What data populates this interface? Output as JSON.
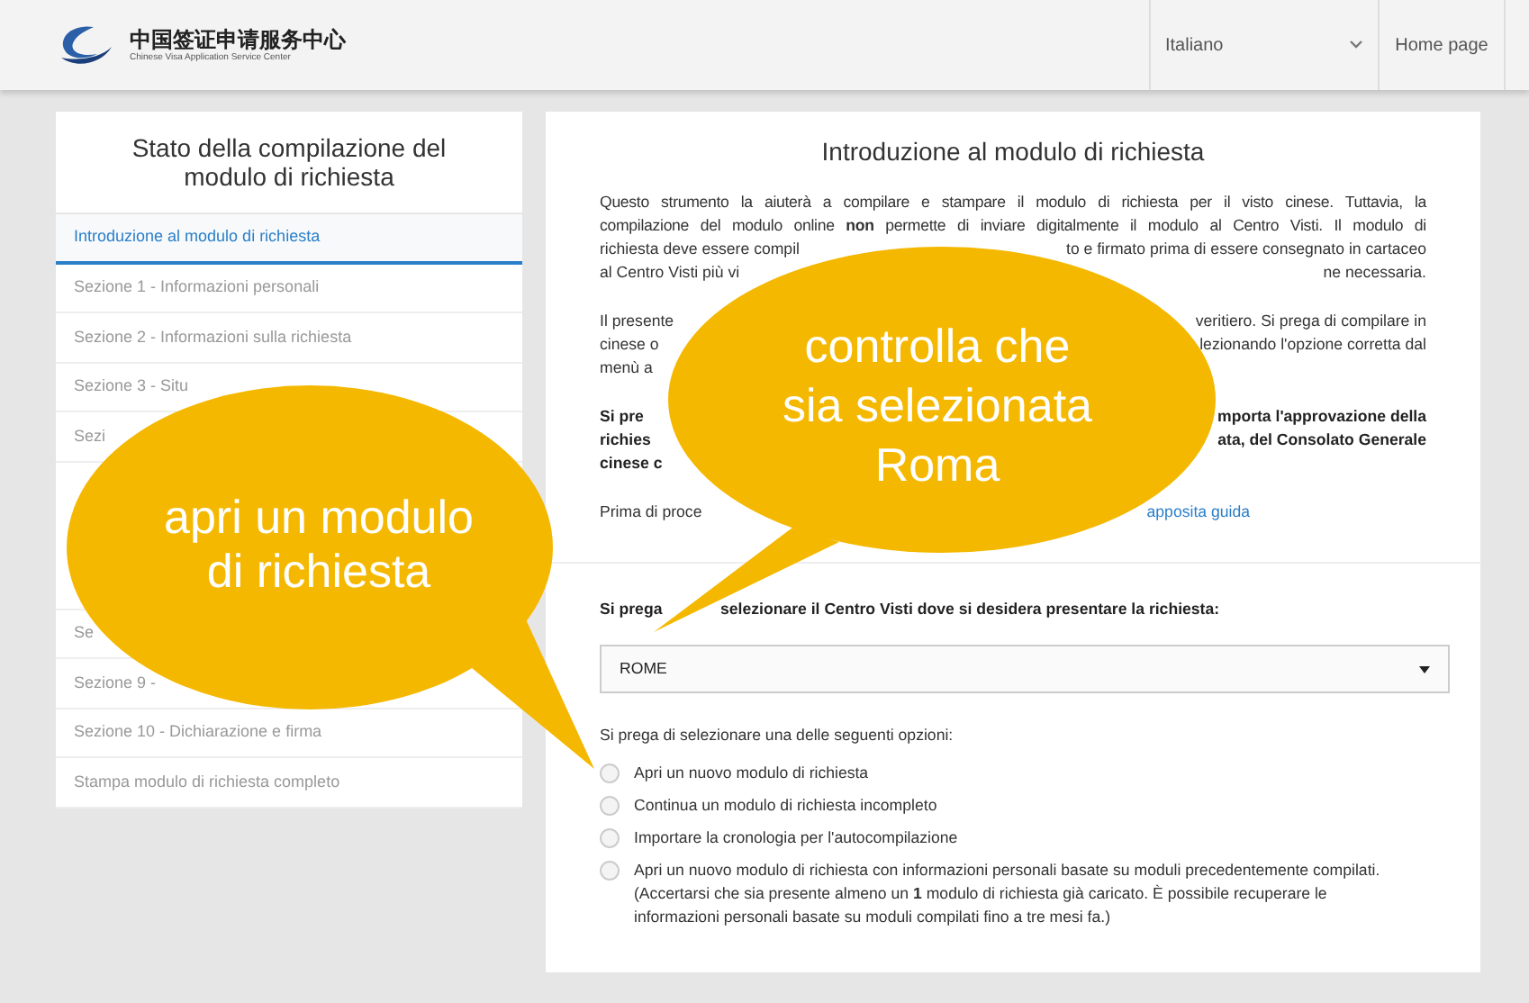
{
  "header": {
    "logo_title": "中国签证申请服务中心",
    "logo_subtitle": "Chinese Visa Application Service Center",
    "language": "Italiano",
    "home_link": "Home page"
  },
  "sidebar": {
    "title": "Stato della compilazione del modulo di richiesta",
    "items": [
      {
        "label": "Introduzione al modulo di richiesta",
        "selected": true
      },
      {
        "label": "Sezione 1 - Informazioni personali",
        "selected": false
      },
      {
        "label": "Sezione 2 - Informazioni sulla richiesta",
        "selected": false
      },
      {
        "label": "Sezione 3 - Situ",
        "selected": false
      },
      {
        "label": "Sezi",
        "selected": false
      },
      {
        "label": "Se",
        "selected": false
      },
      {
        "label": "Sezione 9 -",
        "selected": false
      },
      {
        "label": "Sezione 10 - Dichiarazione e firma",
        "selected": false
      },
      {
        "label": "Stampa modulo di richiesta completo",
        "selected": false
      }
    ]
  },
  "main": {
    "title": "Introduzione al modulo di richiesta",
    "paragraphs": [
      {
        "kind": "normal",
        "lines": [
          {
            "text": "Questo strumento la aiuterà a compilare e stampare il modulo di richiesta per il visto cinese. Tuttavia, la"
          },
          {
            "text": "compilazione del modulo online **non** permette di inviare digitalmente il modulo al Centro Visti. Il modulo di"
          },
          {
            "left": "richiesta deve essere compil",
            "right": "to e firmato prima di essere consegnato in cartaceo"
          },
          {
            "left": "al Centro Visti più vi",
            "right": "ne necessaria."
          }
        ]
      },
      {
        "kind": "normal",
        "lines": [
          {
            "left": "Il presente",
            "right": "veritiero. Si prega di compilare in"
          },
          {
            "left": "cinese o",
            "right": "lezionando l'opzione corretta dal"
          },
          {
            "left": "menù a"
          }
        ]
      },
      {
        "kind": "bold",
        "lines": [
          {
            "left": "Si pre",
            "right": "mporta l'approvazione della"
          },
          {
            "left": "richies",
            "right": "ata, del Consolato Generale"
          },
          {
            "left": "cinese c"
          }
        ]
      },
      {
        "kind": "normal",
        "lines": [
          {
            "left": "Prima di proce",
            "link": "apposita guida"
          }
        ]
      }
    ],
    "center_prompt": {
      "left": "Si prega",
      "right": "selezionare il Centro Visti dove si desidera presentare la richiesta:"
    },
    "center_select": "ROME",
    "options_label": "Si prega di selezionare una delle seguenti opzioni:",
    "options": [
      {
        "label": "Apri un nuovo modulo di richiesta",
        "selected": false
      },
      {
        "label": "Continua un modulo di richiesta incompleto",
        "selected": false
      },
      {
        "label": "Importare la cronologia per l'autocompilazione",
        "selected": false
      },
      {
        "label": "Apri un nuovo modulo di richiesta con informazioni personali basate su moduli precedentemente compilati. (Accertarsi che sia presente almeno un **1** modulo di richiesta già caricato. È possibile recuperare le informazioni personali basate su moduli compilati fino a tre mesi fa.)",
        "selected": false
      }
    ]
  },
  "callouts": [
    {
      "text": "apri un modulo di richiesta"
    },
    {
      "text": "controlla che sia selezionata Roma"
    }
  ]
}
